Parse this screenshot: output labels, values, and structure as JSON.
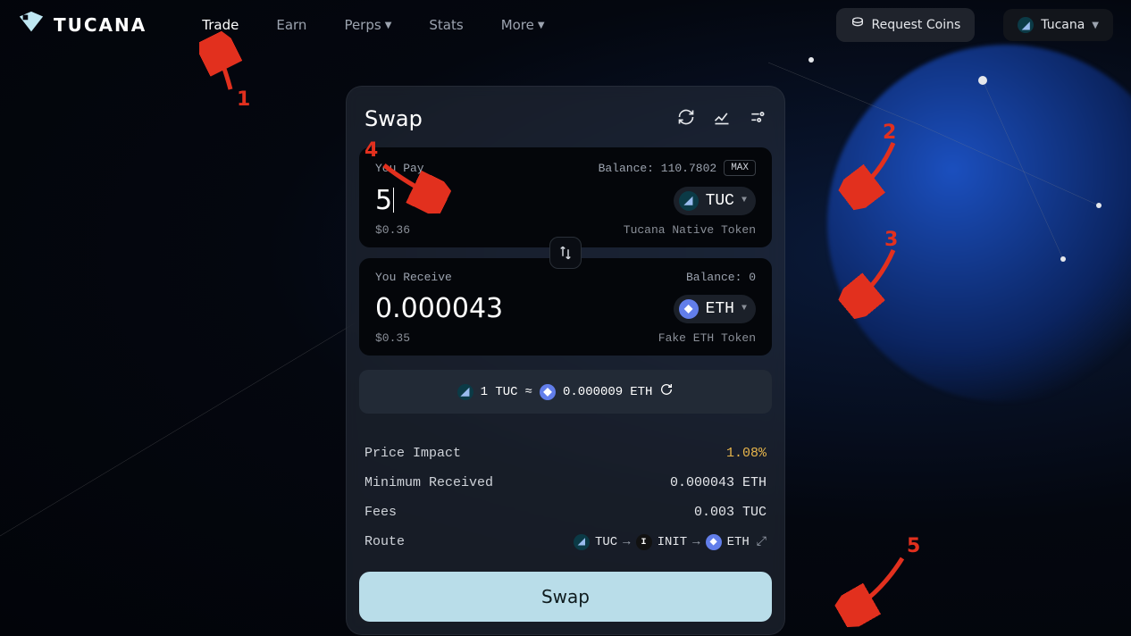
{
  "brand": {
    "name": "TUCANA"
  },
  "nav": {
    "trade": "Trade",
    "earn": "Earn",
    "perps": "Perps",
    "stats": "Stats",
    "more": "More",
    "request_coins": "Request Coins",
    "network": "Tucana"
  },
  "card": {
    "title": "Swap",
    "pay": {
      "label": "You Pay",
      "balance_label": "Balance: 110.7802",
      "max": "MAX",
      "amount": "5",
      "usd": "$0.36",
      "token": "TUC",
      "token_desc": "Tucana Native Token"
    },
    "receive": {
      "label": "You Receive",
      "balance_label": "Balance: 0",
      "amount": "0.000043",
      "usd": "$0.35",
      "token": "ETH",
      "token_desc": "Fake ETH Token"
    },
    "rate": {
      "from_amount": "1 TUC",
      "approx": "≈",
      "to_amount": "0.000009",
      "to_token": "ETH"
    },
    "details": {
      "price_impact_label": "Price Impact",
      "price_impact_value": "1.08%",
      "min_received_label": "Minimum Received",
      "min_received_value": "0.000043 ETH",
      "fees_label": "Fees",
      "fees_value": "0.003 TUC",
      "route_label": "Route",
      "route_tokens": {
        "a": "TUC",
        "b": "INIT",
        "c": "ETH"
      }
    },
    "action": "Swap"
  },
  "annotations": {
    "a1": "1",
    "a2": "2",
    "a3": "3",
    "a4": "4",
    "a5": "5"
  }
}
